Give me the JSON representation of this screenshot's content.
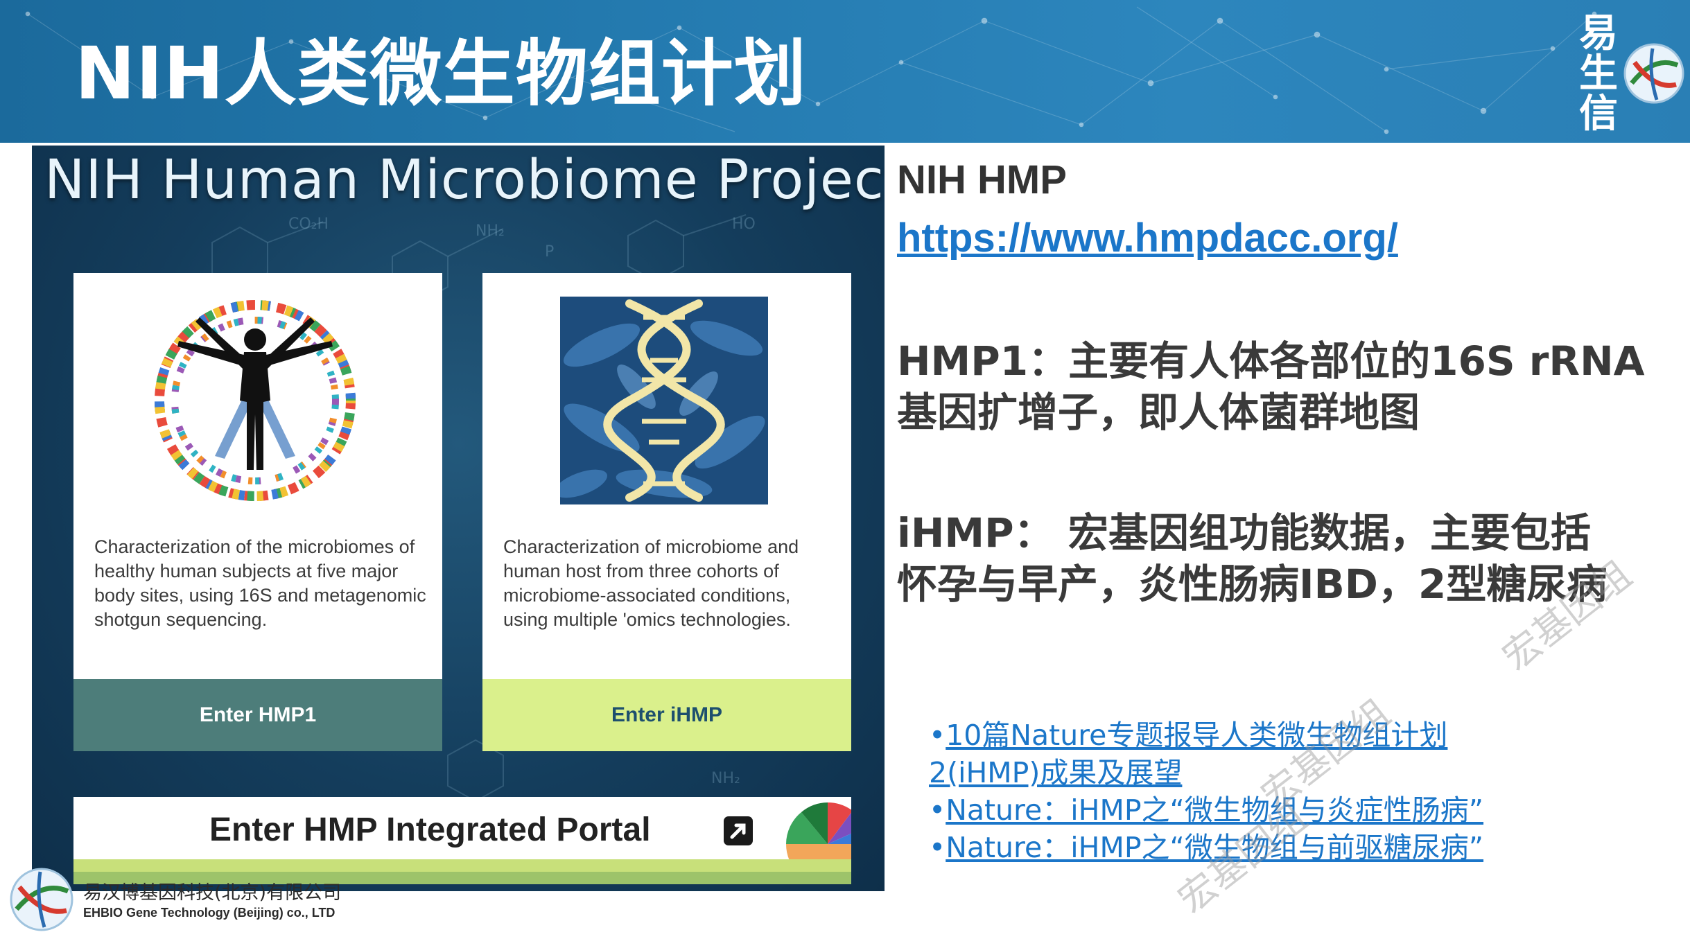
{
  "slide": {
    "title": "NIH人类微生物组计划",
    "brand_logo_text": "易生信"
  },
  "screenshot": {
    "title": "NIH Human Microbiome Project",
    "card_hmp1": {
      "description": "Characterization of the microbiomes of healthy human subjects at five major body sites, using 16S and metagenomic shotgun sequencing.",
      "button_label": "Enter HMP1"
    },
    "card_ihmp": {
      "description": "Characterization of microbiome and human host from three cohorts of microbiome-associated conditions, using multiple 'omics technologies.",
      "button_label": "Enter iHMP"
    },
    "portal_label": "Enter HMP Integrated Portal"
  },
  "right": {
    "heading": "NIH HMP",
    "url": "https://www.hmpdacc.org/",
    "hmp1_line1": "HMP1：主要有人体各部位的16S rRNA",
    "hmp1_line2": "基因扩增子，即人体菌群地图",
    "ihmp_line1": "iHMP： 宏基因组功能数据，主要包括",
    "ihmp_line2": "怀孕与早产，炎性肠病IBD，2型糖尿病",
    "links": [
      {
        "text": "10篇Nature专题报导人类微生物组计划"
      },
      {
        "text": "2(iHMP)成果及展望"
      },
      {
        "text": "Nature：iHMP之“微生物组与炎症性肠病”"
      },
      {
        "text": "Nature：iHMP之“微生物组与前驱糖尿病”"
      }
    ]
  },
  "watermarks": [
    "宏基因组",
    "宏基因组",
    "宏基因组"
  ],
  "company": {
    "name_cn": "易汉博基因科技(北京)有限公司",
    "name_en": "EHBIO Gene Technology (Beijing) co., LTD"
  },
  "colors": {
    "banner": "#2379ae",
    "link": "#1b76c9",
    "hmp1_button": "#4d7d7a",
    "ihmp_button": "#daf08c"
  }
}
